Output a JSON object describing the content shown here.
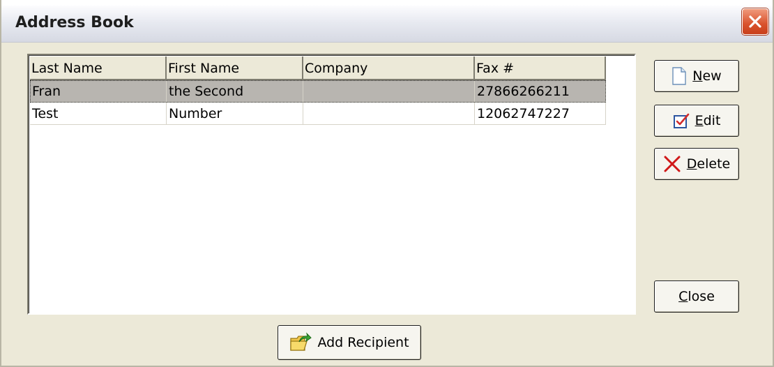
{
  "window": {
    "title": "Address Book"
  },
  "list": {
    "columns": [
      "Last Name",
      "First Name",
      "Company",
      "Fax #"
    ],
    "rows": [
      {
        "last": "Fran",
        "first": "the Second",
        "company": "",
        "fax": "27866266211",
        "selected": true
      },
      {
        "last": "Test",
        "first": "Number",
        "company": "",
        "fax": "12062747227",
        "selected": false
      }
    ]
  },
  "buttons": {
    "new": {
      "accel": "N",
      "rest": "ew",
      "icon": "new-document-icon"
    },
    "edit": {
      "accel": "E",
      "rest": "dit",
      "icon": "edit-checkbox-icon"
    },
    "delete": {
      "accel": "D",
      "rest": "elete",
      "icon": "red-x-icon"
    },
    "close": {
      "accel": "C",
      "rest": "lose"
    },
    "add_recipient": {
      "label": "Add Recipient",
      "icon": "folder-arrow-icon"
    }
  },
  "colors": {
    "selected_row": "#b8b5b0",
    "dialog_bg": "#ece9d8",
    "close_button": "#d9522c"
  }
}
